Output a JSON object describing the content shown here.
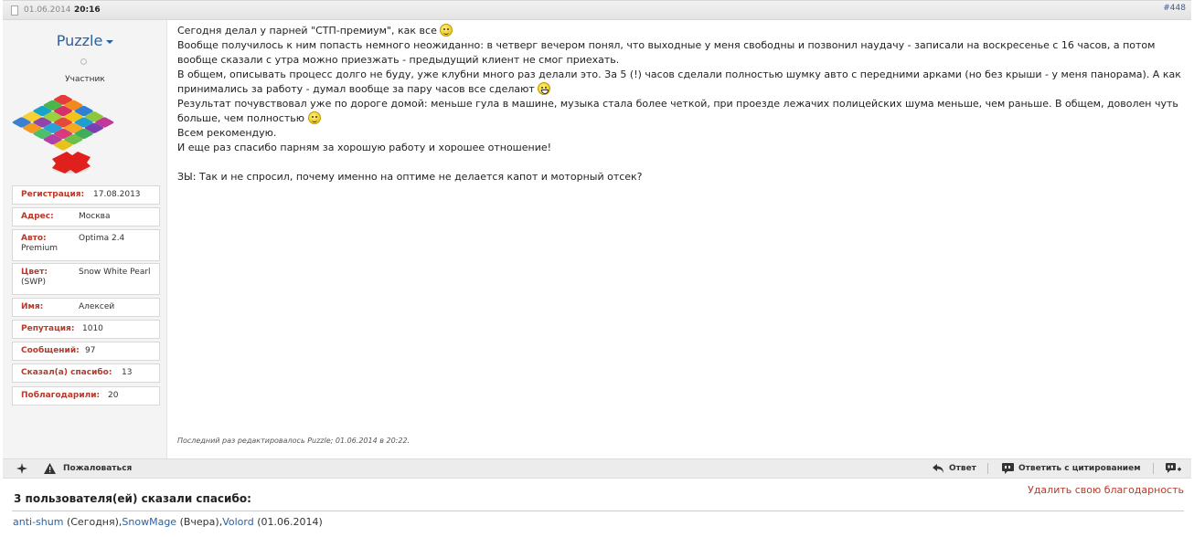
{
  "header": {
    "date": "01.06.2014",
    "time": "20:16",
    "post_number": "#448"
  },
  "user": {
    "name": "Puzzle",
    "role": "Участник",
    "fields": [
      {
        "label": "Регистрация:",
        "value": "17.08.2013"
      },
      {
        "label": "Адрес:",
        "value": "Москва"
      },
      {
        "label": "Авто:",
        "value": "Optima 2.4",
        "value2": "Premium"
      },
      {
        "label": "Цвет:",
        "value": "Snow White Pearl",
        "value2": "(SWP)"
      },
      {
        "label": "Имя:",
        "value": "Алексей"
      },
      {
        "label": "Репутация:",
        "value": "1010"
      },
      {
        "label": "Сообщений:",
        "value": "97"
      },
      {
        "label": "Сказал(а) спасибо:",
        "value": "13"
      },
      {
        "label": "Поблагодарили:",
        "value": "20"
      }
    ]
  },
  "post": {
    "line1": "Сегодня делал у парней \"СТП-премиум\", как все",
    "line2": "Вообще получилось к ним попасть немного неожиданно: в четверг вечером понял, что выходные у меня свободны и позвонил наудачу - записали на воскресенье с 16 часов, а потом вообще сказали с утра можно приезжать - предыдущий клиент не смог приехать.",
    "line3": "В общем, описывать процесс долго не буду, уже клубни много раз делали это. За 5 (!) часов сделали полностью шумку авто с передними арками (но без крыши - у меня панорама). А как принимались за работу - думал вообще за пару часов все сделают",
    "line4": "Результат почувствовал уже по дороге домой: меньше гула в машине, музыка стала более четкой, при проезде лежачих полицейских шума меньше, чем раньше. В общем, доволен чуть больше, чем полностью",
    "line5": "Всем рекомендую.",
    "line6": "И еще раз спасибо парням за хорошую работу и хорошее отношение!",
    "line7": "ЗЫ: Так и не спросил, почему именно на оптиме не делается капот и моторный отсек?",
    "edited": "Последний раз редактировалось Puzzle; 01.06.2014 в 20:22."
  },
  "toolbar": {
    "report": "Пожаловаться",
    "reply": "Ответ",
    "quote": "Ответить с цитированием"
  },
  "thanks": {
    "title": "3 пользователя(ей) сказали спасибо:",
    "remove": "Удалить свою благодарность",
    "users": [
      {
        "name": "anti-shum",
        "when": "(Сегодня),"
      },
      {
        "name": "SnowMage",
        "when": "(Вчера),"
      },
      {
        "name": "Volord",
        "when": "(01.06.2014)"
      }
    ]
  },
  "icons": [
    "document-icon",
    "caret-down-icon",
    "status-dot-icon",
    "smile-icon",
    "grin-icon",
    "star-icon",
    "warning-icon",
    "reply-icon",
    "quote-icon",
    "multiquote-icon"
  ],
  "colors": {
    "link": "#2b5fa3",
    "label": "#b73a2a",
    "sidebar_bg": "#f4f4f4"
  }
}
